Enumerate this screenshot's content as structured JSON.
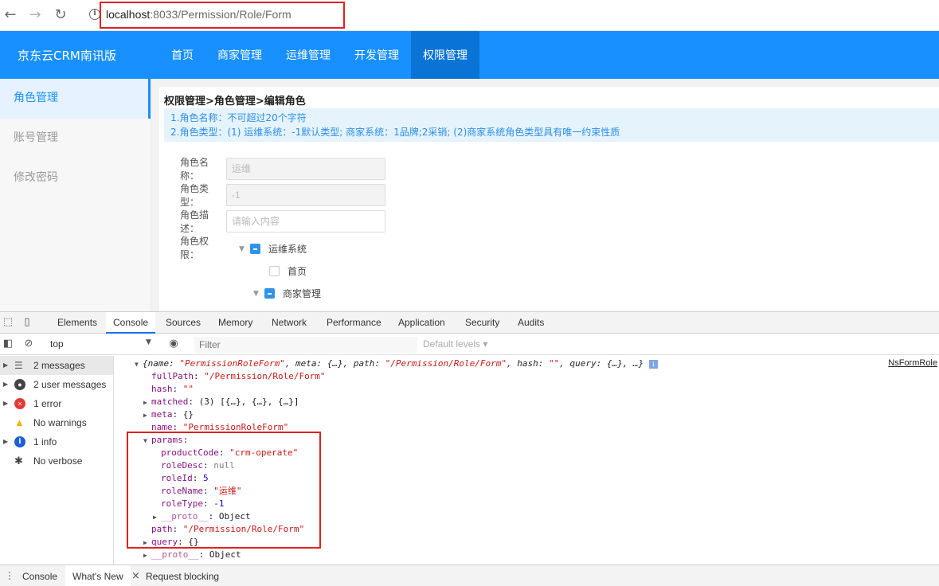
{
  "browser": {
    "back_icon": "←",
    "forward_icon": "→",
    "reload_icon": "↻",
    "info_icon": "i",
    "url_host": "localhost",
    "url_rest": ":8033/Permission/Role/Form"
  },
  "app": {
    "logo": "京东云CRM南讯版",
    "nav": [
      "首页",
      "商家管理",
      "运维管理",
      "开发管理",
      "权限管理"
    ],
    "active_nav": "权限管理",
    "sidebar": [
      "角色管理",
      "账号管理",
      "修改密码"
    ],
    "breadcrumb": "权限管理>角色管理>编辑角色",
    "tips": [
      "1.角色名称：不可超过20个字符",
      "2.角色类型：(1) 运维系统：-1默认类型; 商家系统：1品牌;2采销; (2)商家系统角色类型具有唯一约束性质"
    ],
    "form": {
      "name_label": "角色名称：",
      "name_value": "运维",
      "type_label": "角色类型：",
      "type_value": "-1",
      "desc_label": "角色描述：",
      "desc_placeholder": "请输入内容",
      "perm_label": "角色权限："
    },
    "tree": [
      "运维系统",
      "首页",
      "商家管理"
    ]
  },
  "devtools": {
    "tabs": [
      "Elements",
      "Console",
      "Sources",
      "Memory",
      "Network",
      "Performance",
      "Application",
      "Security",
      "Audits"
    ],
    "active_tab": "Console",
    "context": "top",
    "filter_placeholder": "Filter",
    "levels": "Default levels ▾",
    "sidebar": [
      {
        "label": "2 messages",
        "icon": "list-icon"
      },
      {
        "label": "2 user messages",
        "icon": "user-icon"
      },
      {
        "label": "1 error",
        "icon": "error-icon"
      },
      {
        "label": "No warnings",
        "icon": "warning-icon"
      },
      {
        "label": "1 info",
        "icon": "info-icon"
      },
      {
        "label": "No verbose",
        "icon": "bug-icon"
      }
    ],
    "source_link": "NsFormRole",
    "log": {
      "summary_a": "{name: ",
      "summary_name": "\"PermissionRoleForm\"",
      "summary_b": ", meta: {…}, path: ",
      "summary_path": "\"/Permission/Role/Form\"",
      "summary_c": ", hash: ",
      "summary_hash": "\"\"",
      "summary_d": ", query: {…}, …}",
      "fullPath_key": "fullPath",
      "fullPath_val": "\"/Permission/Role/Form\"",
      "hash_key": "hash",
      "hash_val": "\"\"",
      "matched_key": "matched",
      "matched_val": "(3) [{…}, {…}, {…}]",
      "meta_key": "meta",
      "meta_val": "{}",
      "name_key": "name",
      "name_val": "\"PermissionRoleForm\"",
      "params_key": "params",
      "productCode_key": "productCode",
      "productCode_val": "\"crm-operate\"",
      "roleDesc_key": "roleDesc",
      "roleDesc_val": "null",
      "roleId_key": "roleId",
      "roleId_val": "5",
      "roleName_key": "roleName",
      "roleName_val": "\"运维\"",
      "roleType_key": "roleType",
      "roleType_val": "-1",
      "proto_key": "__proto__",
      "proto_val": "Object",
      "path_key": "path",
      "path_val": "\"/Permission/Role/Form\"",
      "query_key": "query",
      "query_val": "{}"
    },
    "drawer_tabs": [
      "Console",
      "What's New",
      "Request blocking"
    ],
    "drawer_close": "×"
  }
}
